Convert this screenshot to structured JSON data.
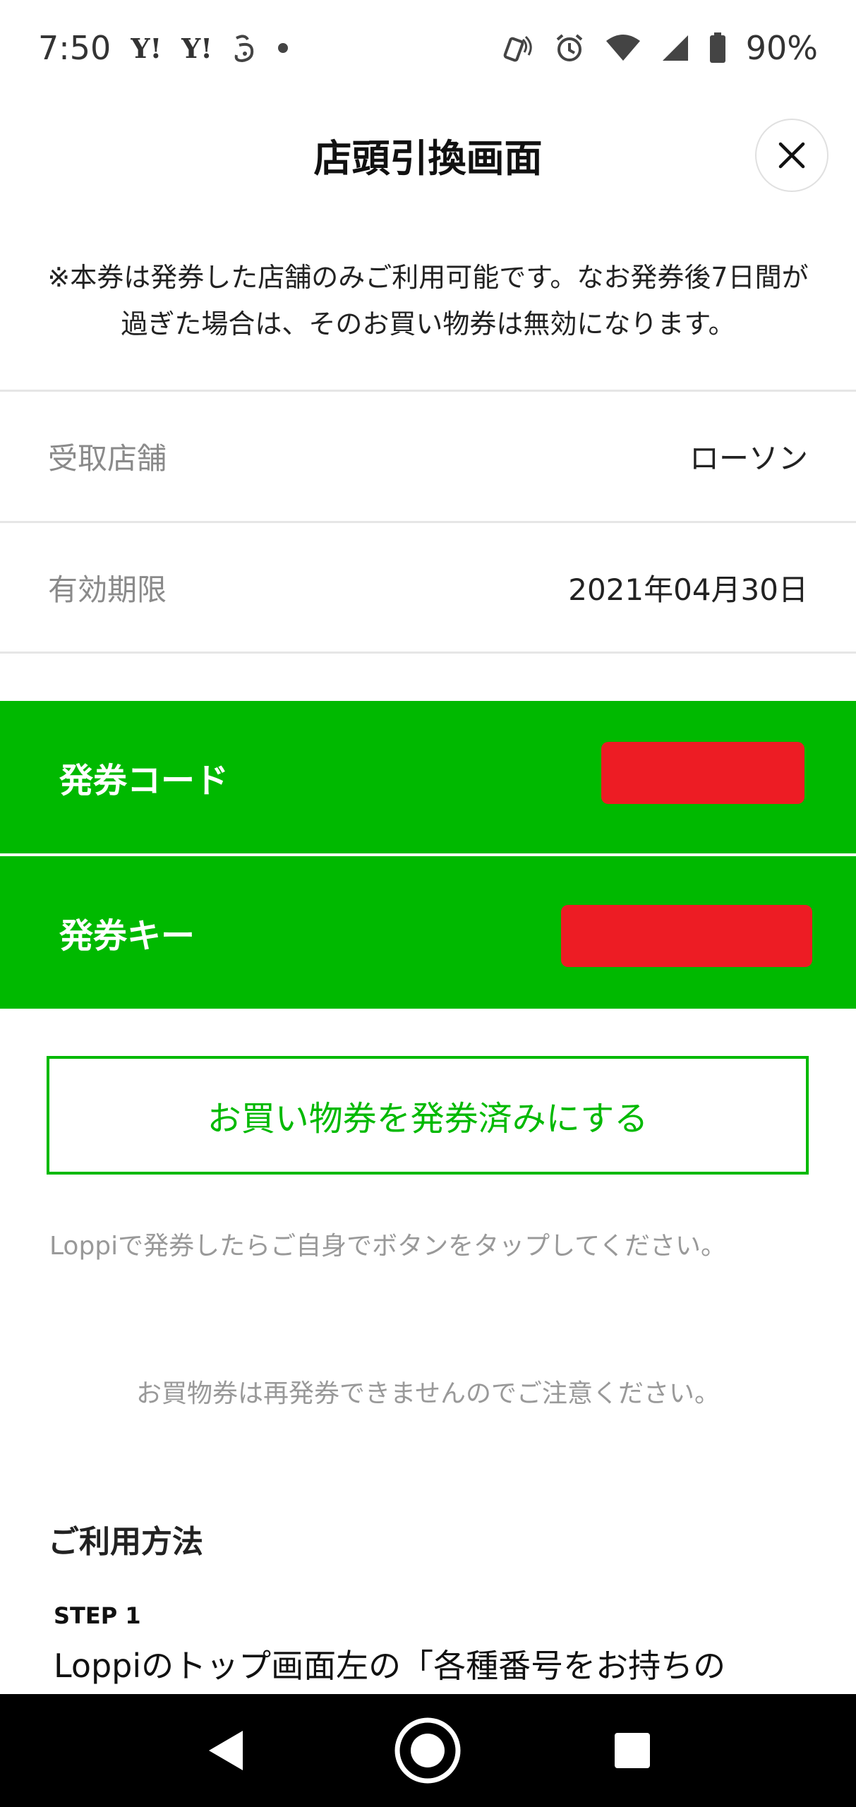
{
  "status_bar": {
    "time": "7:50",
    "notification_icons": [
      "yahoo-icon",
      "yahoo-icon",
      "app-icon",
      "dot-icon"
    ],
    "yahoo_text": "Y!",
    "battery": "90%"
  },
  "header": {
    "title": "店頭引換画面",
    "close_icon": "close-icon"
  },
  "notice": "※本券は発券した店舗のみご利用可能です。なお発券後7日間が過ぎた場合は、そのお買い物券は無効になります。",
  "info": {
    "store_label": "受取店舗",
    "store_value": "ローソン",
    "expiry_label": "有効期限",
    "expiry_value": "2021年04月30日"
  },
  "codes": {
    "issue_code_label": "発券コード",
    "issue_key_label": "発券キー"
  },
  "actions": {
    "mark_issued_label": "お買い物券を発券済みにする"
  },
  "hint": "Loppiで発券したらご自身でボタンをタップしてください。",
  "caution": "お買物券は再発券できませんのでご注意ください。",
  "usage": {
    "title": "ご利用方法",
    "step1_label": "STEP 1",
    "step1_text": "Loppiのトップ画面左の「各種番号をお持ちの"
  },
  "colors": {
    "accent_green": "#00b900",
    "redaction_red": "#ed1c24"
  }
}
